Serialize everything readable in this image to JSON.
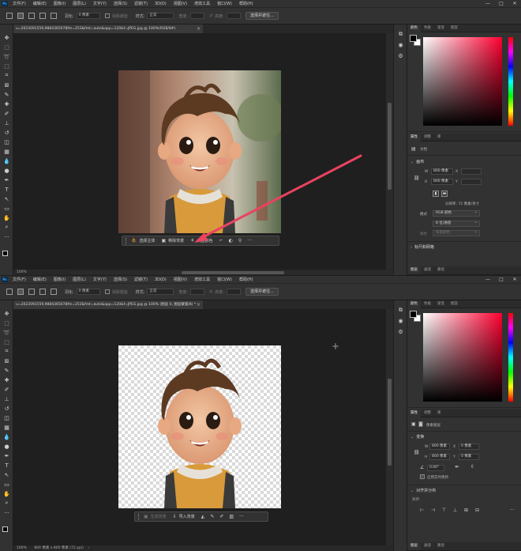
{
  "menu": [
    "文件(F)",
    "编辑(E)",
    "图像(I)",
    "图层(L)",
    "文字(Y)",
    "选择(S)",
    "滤镜(T)",
    "3D(D)",
    "视图(V)",
    "增效工具",
    "窗口(W)",
    "帮助(H)"
  ],
  "app_logo": "Ps",
  "window_controls": {
    "minimize": "—",
    "maximize": "□",
    "close": "✕"
  },
  "options": {
    "feather_label": "羽化:",
    "feather_value": "0 像素",
    "antialias_label": "消除锯齿",
    "style_label": "样式:",
    "style_value": "正常",
    "width_label": "宽度:",
    "height_label": "高度:",
    "select_mask_button": "选择并遮住..."
  },
  "top": {
    "tab_title": "u=2023091559,9884365078fm=253&fmt=auto&app=120&f=JPEG.jpg @ 100%(RGB/8#)",
    "status": "100%",
    "context_bar": {
      "select_subject": "选择主体",
      "remove_background": "移除背景",
      "adjust_color": "调整颜色"
    },
    "panel_tabs": [
      "颜色",
      "色板",
      "渐变",
      "图案"
    ],
    "props_tabs": [
      "属性",
      "调整",
      "库"
    ],
    "doc_label": "文档",
    "canvas_section": "画布",
    "w_label": "W",
    "w_value": "800 像素",
    "h_label": "H",
    "h_value": "800 像素",
    "x_label": "X",
    "y_label": "Y",
    "resolution": "分辨率: 72 像素/英寸",
    "mode_label": "模式",
    "mode_value": "RGB 颜色",
    "depth_value": "8 位/通道",
    "fill_label": "填色",
    "fill_value": "背景颜色",
    "rulers_section": "标尺和网格",
    "bottom_tabs": [
      "图层",
      "通道",
      "路径"
    ]
  },
  "bottom": {
    "tab_title": "u=2023091559,9884365078fm=253&fmt=auto&app=120&f=JPEG.jpg @ 100% (图层 0, 图层蒙版/8) *",
    "status": "100%",
    "status_doc": "800 像素 x 800 像素 (72 ppi)",
    "context_bar": {
      "generate_background": "生成背景",
      "import_background": "导入背景"
    },
    "panel_tabs": [
      "颜色",
      "色板",
      "渐变",
      "图案"
    ],
    "props_tabs": [
      "属性",
      "调整",
      "库"
    ],
    "pixel_layer_label": "像素图层",
    "transform_section": "变换",
    "w_label": "W",
    "w_value": "800 像素",
    "h_label": "H",
    "h_value": "800 像素",
    "x_label": "X",
    "x_value": "0 像素",
    "y_label": "Y",
    "y_value": "0 像素",
    "angle_value": "0.00°",
    "realtime_label": "启用实时更新",
    "align_section": "对齐并分布",
    "align_label": "对齐:",
    "bottom_tabs": [
      "图层",
      "通道",
      "路径"
    ]
  },
  "colors": {
    "arrow": "#e8435f",
    "accent": "#31a8ff"
  }
}
